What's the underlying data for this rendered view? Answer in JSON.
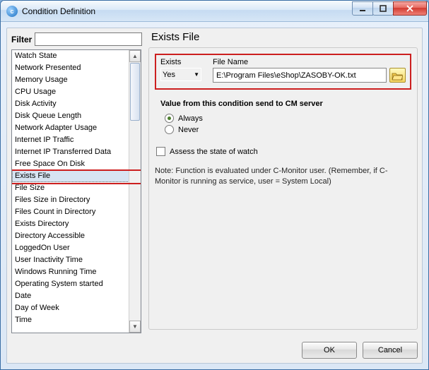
{
  "window": {
    "title": "Condition Definition"
  },
  "filter": {
    "label": "Filter",
    "value": ""
  },
  "list": {
    "items": [
      "Watch State",
      "Network Presented",
      "Memory Usage",
      "CPU Usage",
      "Disk Activity",
      "Disk Queue Length",
      "Network Adapter Usage",
      "Internet IP Traffic",
      "Internet IP Transferred Data",
      "Free Space On Disk",
      "Exists File",
      "File Size",
      "Files Size in Directory",
      "Files Count in Directory",
      "Exists Directory",
      "Directory Accessible",
      "LoggedOn User",
      "User Inactivity Time",
      "Windows Running Time",
      "Operating System started",
      "Date",
      "Day of Week",
      "Time"
    ],
    "selected_index": 10
  },
  "detail": {
    "title": "Exists File",
    "exists_label": "Exists",
    "exists_value": "Yes",
    "filename_label": "File Name",
    "filename_value": "E:\\Program Files\\eShop\\ZASOBY-OK.txt",
    "send_header": "Value from this condition send to CM server",
    "radio_always": "Always",
    "radio_never": "Never",
    "radio_selected": "always",
    "assess_label": "Assess the state of watch",
    "note": "Note: Function is evaluated under C-Monitor user. (Remember, if C-Monitor is running as service, user = System Local)"
  },
  "buttons": {
    "ok": "OK",
    "cancel": "Cancel"
  }
}
